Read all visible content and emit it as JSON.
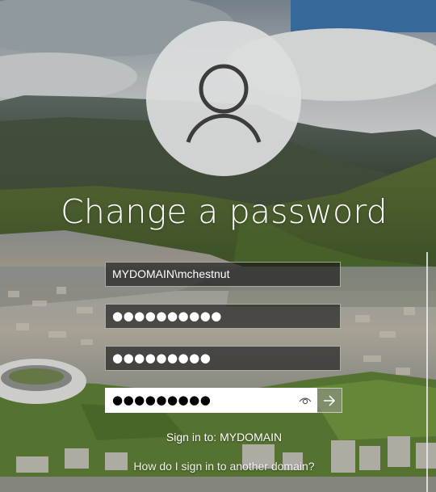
{
  "screen": {
    "title": "Change a password"
  },
  "avatar": {
    "icon": "user-icon"
  },
  "form": {
    "username_value": "MYDOMAIN\\mchestnut",
    "old_password_mask": "●●●●●●●●●●",
    "new_password_mask": "●●●●●●●●●",
    "confirm_password_mask": "●●●●●●●●●",
    "reveal_icon": "eye-icon",
    "submit_icon": "arrow-right-icon"
  },
  "footer": {
    "sign_in_to": "Sign in to: MYDOMAIN",
    "help_link": "How do I sign in to another domain?"
  },
  "colors": {
    "field_background": "#141414",
    "confirm_background": "#ffffff",
    "avatar_background": "#dcdede",
    "avatar_glyph": "#3c3c3c"
  }
}
